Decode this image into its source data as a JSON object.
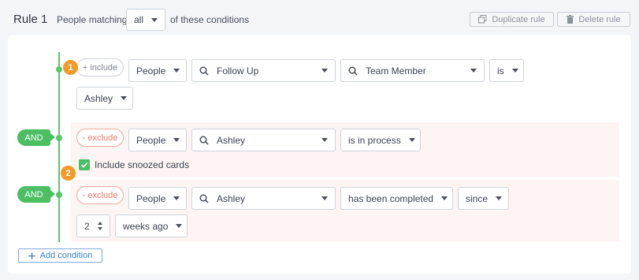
{
  "rule": {
    "title": "Rule 1",
    "matching_prefix": "People matching",
    "matching_value": "all",
    "matching_suffix": "of these conditions",
    "duplicate_label": "Duplicate rule",
    "delete_label": "Delete rule"
  },
  "connector": {
    "and_label": "AND"
  },
  "steps": {
    "one": "1",
    "two": "2"
  },
  "conditions": [
    {
      "mode": "+ include",
      "entity": "People",
      "search": "Follow Up",
      "field": "Team Member",
      "operator": "is",
      "value": "Ashley"
    },
    {
      "mode": "- exclude",
      "entity": "People",
      "search": "Ashley",
      "operator": "is in process",
      "checkbox_label": "Include snoozed cards",
      "checkbox_checked": true
    },
    {
      "mode": "- exclude",
      "entity": "People",
      "search": "Ashley",
      "operator": "has been completed",
      "qualifier": "since",
      "amount": "2",
      "unit": "weeks ago"
    }
  ],
  "add_condition_label": "Add condition",
  "colors": {
    "accent_green": "#4cbf63",
    "exclude_red": "#ef7b6c",
    "step_orange": "#f39a2b",
    "link_blue": "#3f7fcf",
    "exclude_bg": "#fdf5f3"
  },
  "icons": {
    "duplicate": "duplicate-icon",
    "delete": "trash-icon",
    "search": "search-icon",
    "check": "check-icon",
    "plus": "plus-icon"
  }
}
